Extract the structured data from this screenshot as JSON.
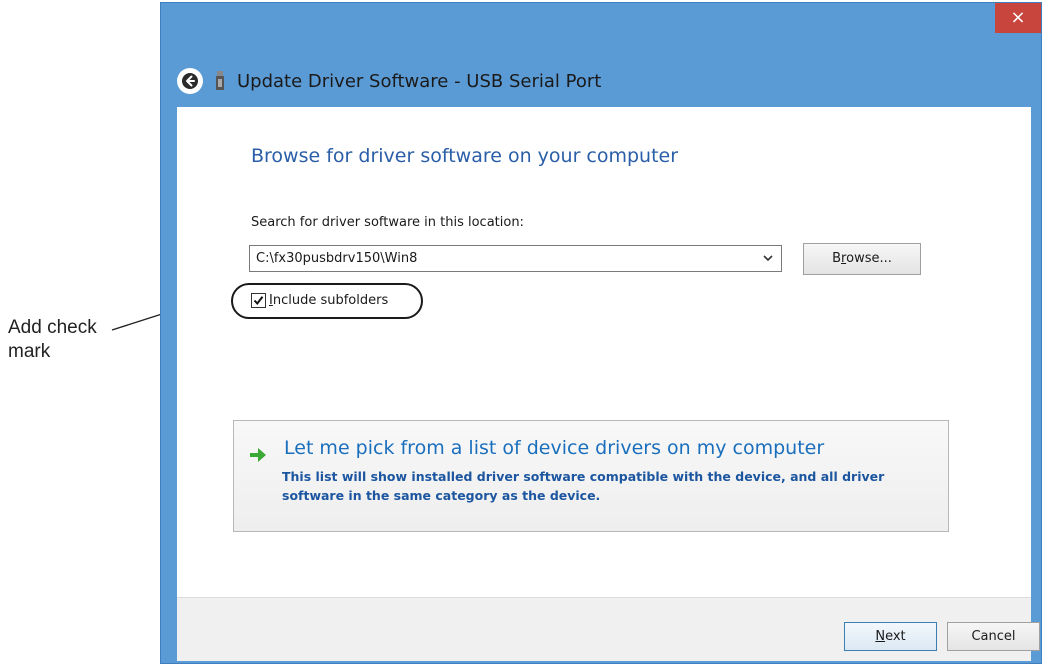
{
  "annotation": {
    "line1": "Add check",
    "line2": "mark"
  },
  "window": {
    "title": "Update Driver Software - USB Serial Port",
    "close_glyph": "×",
    "icons": {
      "back": "back-arrow-icon",
      "device": "usb-device-icon",
      "close": "close-icon"
    }
  },
  "content": {
    "section_title": "Browse for driver software on your computer",
    "search_label": "Search for driver software in this location:",
    "path_value": "C:\\fx30pusbdrv150\\Win8",
    "browse_prefix": "B",
    "browse_mnemonic": "r",
    "browse_suffix": "owse...",
    "include_subfolders": {
      "checked": true,
      "mnemonic": "I",
      "label_rest": "nclude subfolders"
    },
    "pick_option": {
      "title": "Let me pick from a list of device drivers on my computer",
      "description": "This list will show installed driver software compatible with the device, and all driver software in the same category as the device.",
      "icon": "green-arrow-icon"
    }
  },
  "footer": {
    "next_mnemonic": "N",
    "next_rest": "ext",
    "cancel_label": "Cancel"
  },
  "colors": {
    "title_bar": "#5b9bd5",
    "close_button": "#c7453d",
    "section_title": "#2a5ea8",
    "link": "#1a6fbd"
  }
}
